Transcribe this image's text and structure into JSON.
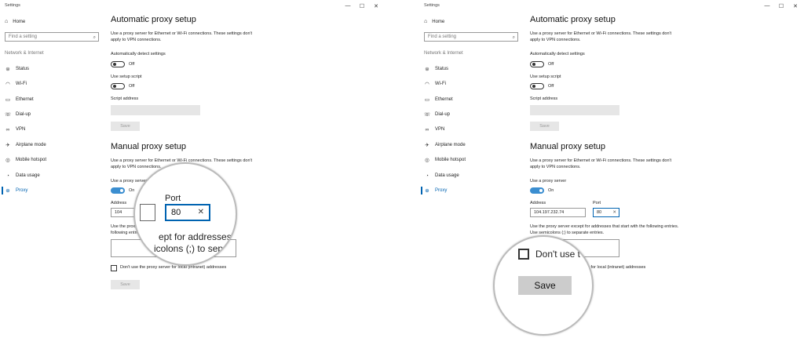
{
  "window": {
    "title": "Settings",
    "controls": {
      "minimize": "—",
      "maximize": "☐",
      "close": "✕"
    }
  },
  "sidebar": {
    "home": "Home",
    "search_placeholder": "Find a setting",
    "section": "Network & Internet",
    "items": [
      {
        "label": "Status",
        "icon": "status-icon"
      },
      {
        "label": "Wi-Fi",
        "icon": "wifi-icon"
      },
      {
        "label": "Ethernet",
        "icon": "ethernet-icon"
      },
      {
        "label": "Dial-up",
        "icon": "dialup-icon"
      },
      {
        "label": "VPN",
        "icon": "vpn-icon"
      },
      {
        "label": "Airplane mode",
        "icon": "airplane-icon"
      },
      {
        "label": "Mobile hotspot",
        "icon": "hotspot-icon"
      },
      {
        "label": "Data usage",
        "icon": "data-usage-icon"
      },
      {
        "label": "Proxy",
        "icon": "proxy-icon"
      }
    ],
    "active": "Proxy"
  },
  "automatic": {
    "title": "Automatic proxy setup",
    "desc": "Use a proxy server for Ethernet or Wi-Fi connections. These settings don't apply to VPN connections.",
    "detect_label": "Automatically detect settings",
    "detect_state": "Off",
    "script_label": "Use setup script",
    "script_state": "Off",
    "address_label": "Script address",
    "save": "Save"
  },
  "manual": {
    "title": "Manual proxy setup",
    "desc": "Use a proxy server for Ethernet or Wi-Fi connections. These settings don't apply to VPN connections.",
    "use_proxy_label": "Use a proxy server",
    "use_proxy_state": "On",
    "address_label": "Address",
    "address_value": "104.197.232.74",
    "port_label": "Port",
    "port_value": "80",
    "exceptions_desc": "Use the proxy server except for addresses that start with the following entries. Use semicolons (;) to separate entries.",
    "local_label": "Don't use the proxy server for local (intranet) addresses",
    "save": "Save"
  },
  "left_view": {
    "address_partial": "104",
    "use_proxy_partial": "Use a proxy server",
    "exceptions_partial_1": "Use the proxy",
    "exceptions_partial_2": "following entri",
    "magnifier": {
      "port_label": "Port",
      "port_value": "80",
      "text1": "ept for addresses that s",
      "text2": "icolons (;) to separa"
    }
  },
  "right_view": {
    "magnifier": {
      "checkbox_label": "Don't use t",
      "save": "Save"
    }
  },
  "colors": {
    "accent": "#0063b1",
    "toggle_on": "#3b8ed0"
  }
}
